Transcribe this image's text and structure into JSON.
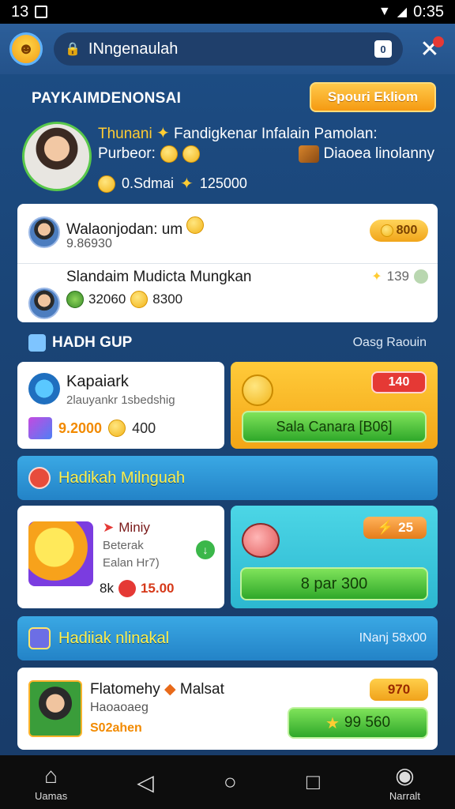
{
  "status": {
    "time_left": "13",
    "time_right": "0:35"
  },
  "browser": {
    "url": "INngenaulah",
    "tab_count": "0"
  },
  "profile": {
    "title": "PAYKAIMDENONSAI",
    "action_button": "Spouri Ekliom",
    "line1_name": "Thunani",
    "line1_rest": "Fandigkenar Infalain Pamolan:",
    "line2": "Purbeor:",
    "line2_right": "Diaoea linolanny",
    "line3_a": "0.Sdmai",
    "line3_b": "125000"
  },
  "list": [
    {
      "title": "Walaonjodan: um",
      "sub": "9.86930",
      "badge": "800"
    },
    {
      "title": "Slandaim Mudicta Mungkan",
      "sub_a": "32060",
      "sub_b": "8300",
      "right": "139"
    }
  ],
  "section1": {
    "title": "HADH GUP",
    "right": "Oasg Raouin"
  },
  "game_card": {
    "title": "Kapaiark",
    "sub": "2lauyankr   1sbedshig",
    "price": "9.2000",
    "price_b": "400"
  },
  "promo_card": {
    "badge": "140",
    "button": "Sala Canara [B06]"
  },
  "banner1": {
    "title": "Hadikah Milnguah"
  },
  "reward_card": {
    "title": "Miniy",
    "sub1": "Beterak",
    "sub2": "Ealan Hr7)",
    "price_label": "8k",
    "price": "15.00"
  },
  "teal_card": {
    "badge": "25",
    "button": "8 par 300"
  },
  "banner2": {
    "title": "Hadiiak nlinakal",
    "right": "INanj 58x00"
  },
  "bottom_card": {
    "title": "Flatomehy",
    "title_b": "Malsat",
    "sub1": "Haoaoaeg",
    "sub2": "S02ahen",
    "badge": "970",
    "button": "99 560"
  },
  "nav": {
    "home_label": "Uamas",
    "profile_label": "Narralt"
  }
}
